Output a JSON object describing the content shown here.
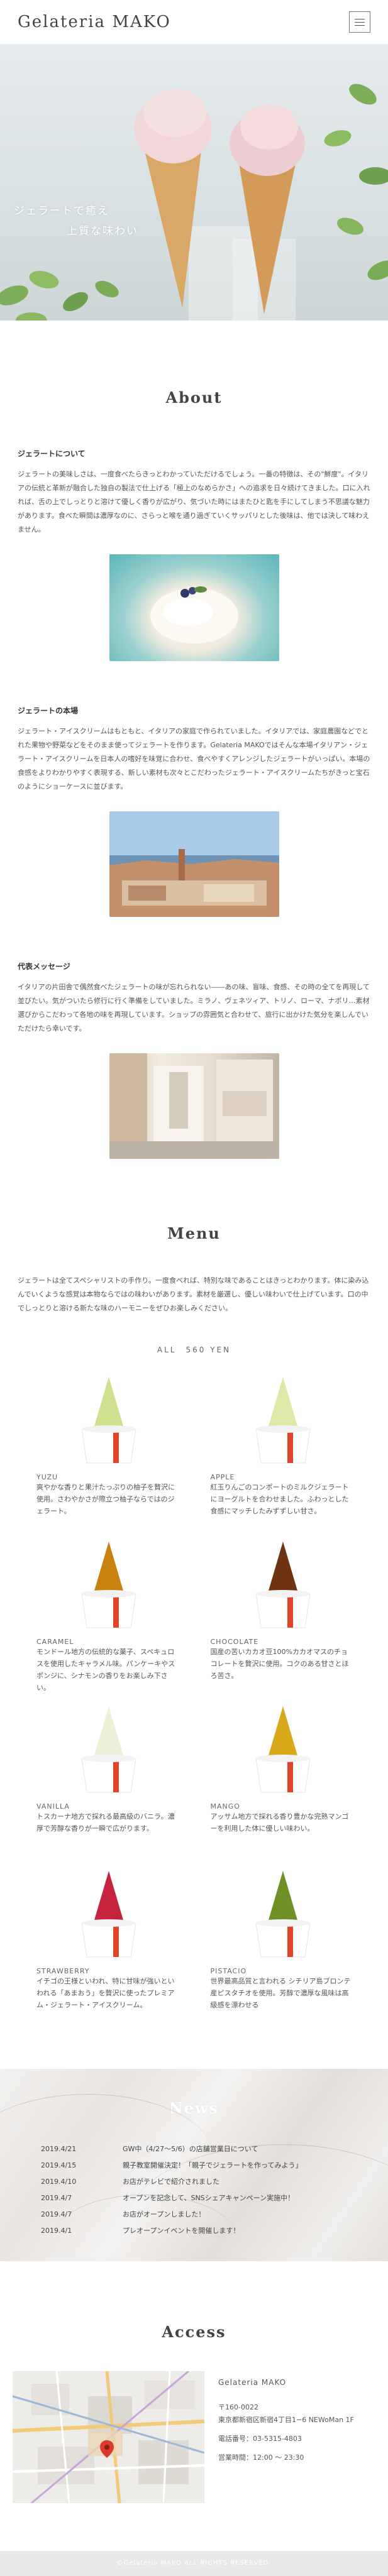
{
  "header": {
    "logo": "Gelateria MAKO",
    "menu_icon": "hamburger-icon"
  },
  "hero": {
    "line1": "ジェラートで癒え",
    "line2": "上質な味わい"
  },
  "about": {
    "title": "About",
    "block1": {
      "heading": "ジェラートについて",
      "text": "ジェラートの美味しさは、一度食べたらきっとわかっていただけるでしょう。一番の特徴は、その\"鮮度\"。イタリアの伝統と革新が融合した独自の製法で仕上げる「極上のなめらかさ」への追求を日々続けてきました。口に入れれば、舌の上でしっとりと溶けて優しく香りが広がり、気づいた時にはまたひと匙を手にしてしまう不思議な魅力があります。食べた瞬間は濃厚なのに、さらっと喉を通り過ぎていくサッパリとした後味は、他では決して味わえません。"
    },
    "block2": {
      "heading": "ジェラートの本場",
      "text": "ジェラート・アイスクリームはもともと、イタリアの家庭で作られていました。イタリアでは、家庭農園などでとれた果物や野菜などをそのまま使ってジェラートを作ります。Gelateria MAKOではそんな本場イタリアン・ジェラート・アイスクリームを日本人の嗜好を味覚に合わせ、食べやすくアレンジしたジェラートがいっぱい。本場の食感をよりわかりやすく表現する、新しい素材も次々とこだわったジェラート・アイスクリームたちがきっと宝石のようにショーケースに並びます。"
    },
    "block3": {
      "heading": "代表メッセージ",
      "text": "イタリアの片田舎で偶然食べたジェラートの味が忘れられない――あの味、盲味、食感、その時の全てを再現して並びたい。気がついたら修行に行く準備をしていました。ミラノ、ヴェネツィア、トリノ、ローマ、ナポリ…素材選びからこだわって各地の味を再現しています。ショップの雰囲気と合わせて、旅行に出かけた気分を楽しんでいただけたら幸いです。"
    }
  },
  "menu": {
    "title": "Menu",
    "intro": "ジェラートは全てスペシャリストの手作り。一度食べれば、特別な味であることはきっとわかります。体に染み込んでいくような感覚は本物ならではの味わいがあります。素材を厳選し、優しい味わいで仕上げています。口の中でしっとりと溶ける新たな味のハーモニーをぜひお楽しみください。",
    "price": "ALL　560 YEN",
    "flavors": [
      {
        "name": "YUZU",
        "desc": "爽やかな香りと果汁たっぷりの柚子を贅沢に使用。さわやかさが際立つ柚子ならではのジェラート。",
        "color": "#cfe08e"
      },
      {
        "name": "APPLE",
        "desc": "紅玉りんごのコンポートのミルクジェラートにヨーグルトを合わせました。ふわっとした食感にマッチしたみずずしい甘さ。",
        "color": "#dde9a6"
      },
      {
        "name": "CARAMEL",
        "desc": "モンドール地方の伝統的な菓子、スペキュロスを使用したキャラメル味。パンケーキやスポンジに、シナモンの香りをお楽しみ下さい。",
        "color": "#c9820f"
      },
      {
        "name": "CHOCOLATE",
        "desc": "国産の苦いカカオ豆100%カカオマスのチョコレートを贅沢に使用。コクのある甘さとほろ苦さ。",
        "color": "#6e3411"
      },
      {
        "name": "VANILLA",
        "desc": "トスカーナ地方で採れる最高級のバニラ。濃厚で芳醇な香りが一瞬で広がります。",
        "color": "#eef0d8"
      },
      {
        "name": "MANGO",
        "desc": "アッサム地方で採れる香り豊かな完熟マンゴーを利用した体に優しい味わい。",
        "color": "#d9a81b"
      },
      {
        "name": "STRAWBERRY",
        "desc": "イチゴの王様といわれ、特に甘味が強いといわれる「あまおう」を贅沢に使ったプレミアム・ジェラート・アイスクリーム。",
        "color": "#c6243e"
      },
      {
        "name": "PISTACIO",
        "desc": "世界最高品質と言われる シチリア島ブロンテ産ピスタチオを使用。芳醇で濃厚な風味は高級感を漂わせる",
        "color": "#6f8f27"
      }
    ]
  },
  "news": {
    "title": "News",
    "items": [
      {
        "date": "2019.4/21",
        "text": "GW中（4/27〜5/6）の店舗営業日について"
      },
      {
        "date": "2019.4/15",
        "text": "親子教室開催決定！「親子でジェラートを作ってみよう」"
      },
      {
        "date": "2019.4/10",
        "text": "お店がテレビで紹介されました"
      },
      {
        "date": "2019.4/7",
        "text": "オープンを記念して、SNSシェアキャンペーン実施中！"
      },
      {
        "date": "2019.4/7",
        "text": "お店がオープンしました！"
      },
      {
        "date": "2019.4/1",
        "text": "プレオープンイベントを開催します！"
      }
    ]
  },
  "access": {
    "title": "Access",
    "shop_name": "Gelateria MAKO",
    "zip": "〒160-0022",
    "address": "東京都新宿区新宿4丁目1−6 NEWoMan 1F",
    "phone": "電話番号：03-5315-4803",
    "hours": "営業時間：12:00 ～ 23:30"
  },
  "footer": {
    "copyright": "©Gelateria MAKO ALL RIGHTS RESERVED."
  }
}
